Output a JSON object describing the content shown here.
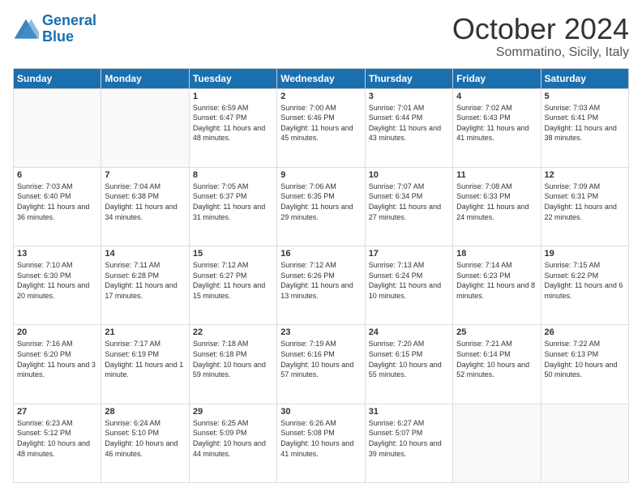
{
  "header": {
    "logo_line1": "General",
    "logo_line2": "Blue",
    "month": "October 2024",
    "location": "Sommatino, Sicily, Italy"
  },
  "days_of_week": [
    "Sunday",
    "Monday",
    "Tuesday",
    "Wednesday",
    "Thursday",
    "Friday",
    "Saturday"
  ],
  "weeks": [
    [
      {
        "day": "",
        "info": ""
      },
      {
        "day": "",
        "info": ""
      },
      {
        "day": "1",
        "info": "Sunrise: 6:59 AM\nSunset: 6:47 PM\nDaylight: 11 hours and 48 minutes."
      },
      {
        "day": "2",
        "info": "Sunrise: 7:00 AM\nSunset: 6:46 PM\nDaylight: 11 hours and 45 minutes."
      },
      {
        "day": "3",
        "info": "Sunrise: 7:01 AM\nSunset: 6:44 PM\nDaylight: 11 hours and 43 minutes."
      },
      {
        "day": "4",
        "info": "Sunrise: 7:02 AM\nSunset: 6:43 PM\nDaylight: 11 hours and 41 minutes."
      },
      {
        "day": "5",
        "info": "Sunrise: 7:03 AM\nSunset: 6:41 PM\nDaylight: 11 hours and 38 minutes."
      }
    ],
    [
      {
        "day": "6",
        "info": "Sunrise: 7:03 AM\nSunset: 6:40 PM\nDaylight: 11 hours and 36 minutes."
      },
      {
        "day": "7",
        "info": "Sunrise: 7:04 AM\nSunset: 6:38 PM\nDaylight: 11 hours and 34 minutes."
      },
      {
        "day": "8",
        "info": "Sunrise: 7:05 AM\nSunset: 6:37 PM\nDaylight: 11 hours and 31 minutes."
      },
      {
        "day": "9",
        "info": "Sunrise: 7:06 AM\nSunset: 6:35 PM\nDaylight: 11 hours and 29 minutes."
      },
      {
        "day": "10",
        "info": "Sunrise: 7:07 AM\nSunset: 6:34 PM\nDaylight: 11 hours and 27 minutes."
      },
      {
        "day": "11",
        "info": "Sunrise: 7:08 AM\nSunset: 6:33 PM\nDaylight: 11 hours and 24 minutes."
      },
      {
        "day": "12",
        "info": "Sunrise: 7:09 AM\nSunset: 6:31 PM\nDaylight: 11 hours and 22 minutes."
      }
    ],
    [
      {
        "day": "13",
        "info": "Sunrise: 7:10 AM\nSunset: 6:30 PM\nDaylight: 11 hours and 20 minutes."
      },
      {
        "day": "14",
        "info": "Sunrise: 7:11 AM\nSunset: 6:28 PM\nDaylight: 11 hours and 17 minutes."
      },
      {
        "day": "15",
        "info": "Sunrise: 7:12 AM\nSunset: 6:27 PM\nDaylight: 11 hours and 15 minutes."
      },
      {
        "day": "16",
        "info": "Sunrise: 7:12 AM\nSunset: 6:26 PM\nDaylight: 11 hours and 13 minutes."
      },
      {
        "day": "17",
        "info": "Sunrise: 7:13 AM\nSunset: 6:24 PM\nDaylight: 11 hours and 10 minutes."
      },
      {
        "day": "18",
        "info": "Sunrise: 7:14 AM\nSunset: 6:23 PM\nDaylight: 11 hours and 8 minutes."
      },
      {
        "day": "19",
        "info": "Sunrise: 7:15 AM\nSunset: 6:22 PM\nDaylight: 11 hours and 6 minutes."
      }
    ],
    [
      {
        "day": "20",
        "info": "Sunrise: 7:16 AM\nSunset: 6:20 PM\nDaylight: 11 hours and 3 minutes."
      },
      {
        "day": "21",
        "info": "Sunrise: 7:17 AM\nSunset: 6:19 PM\nDaylight: 11 hours and 1 minute."
      },
      {
        "day": "22",
        "info": "Sunrise: 7:18 AM\nSunset: 6:18 PM\nDaylight: 10 hours and 59 minutes."
      },
      {
        "day": "23",
        "info": "Sunrise: 7:19 AM\nSunset: 6:16 PM\nDaylight: 10 hours and 57 minutes."
      },
      {
        "day": "24",
        "info": "Sunrise: 7:20 AM\nSunset: 6:15 PM\nDaylight: 10 hours and 55 minutes."
      },
      {
        "day": "25",
        "info": "Sunrise: 7:21 AM\nSunset: 6:14 PM\nDaylight: 10 hours and 52 minutes."
      },
      {
        "day": "26",
        "info": "Sunrise: 7:22 AM\nSunset: 6:13 PM\nDaylight: 10 hours and 50 minutes."
      }
    ],
    [
      {
        "day": "27",
        "info": "Sunrise: 6:23 AM\nSunset: 5:12 PM\nDaylight: 10 hours and 48 minutes."
      },
      {
        "day": "28",
        "info": "Sunrise: 6:24 AM\nSunset: 5:10 PM\nDaylight: 10 hours and 46 minutes."
      },
      {
        "day": "29",
        "info": "Sunrise: 6:25 AM\nSunset: 5:09 PM\nDaylight: 10 hours and 44 minutes."
      },
      {
        "day": "30",
        "info": "Sunrise: 6:26 AM\nSunset: 5:08 PM\nDaylight: 10 hours and 41 minutes."
      },
      {
        "day": "31",
        "info": "Sunrise: 6:27 AM\nSunset: 5:07 PM\nDaylight: 10 hours and 39 minutes."
      },
      {
        "day": "",
        "info": ""
      },
      {
        "day": "",
        "info": ""
      }
    ]
  ]
}
